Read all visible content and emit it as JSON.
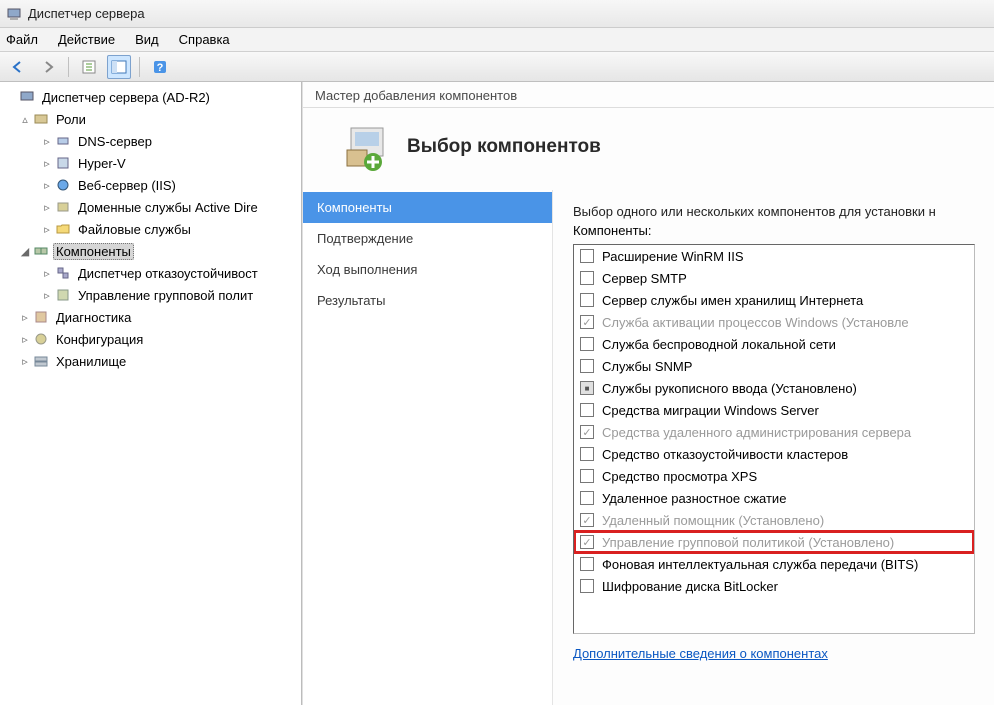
{
  "titlebar": {
    "title": "Диспетчер сервера"
  },
  "menubar": {
    "file": "Файл",
    "action": "Действие",
    "view": "Вид",
    "help": "Справка"
  },
  "tree": {
    "root": "Диспетчер сервера (AD-R2)",
    "roles": "Роли",
    "dns": "DNS-сервер",
    "hyperv": "Hyper-V",
    "iis": "Веб-сервер (IIS)",
    "addomain": "Доменные службы Active Dire",
    "fileservices": "Файловые службы",
    "components": "Компоненты",
    "failover": "Диспетчер отказоустойчивост",
    "gpm": "Управление групповой полит",
    "diagnostics": "Диагностика",
    "config": "Конфигурация",
    "storage": "Хранилище"
  },
  "wizard": {
    "title": "Мастер добавления компонентов",
    "header": "Выбор компонентов",
    "steps": {
      "components": "Компоненты",
      "confirm": "Подтверждение",
      "progress": "Ход выполнения",
      "results": "Результаты"
    },
    "desc": "Выбор одного или нескольких компонентов для установки н",
    "listLabel": "Компоненты:",
    "moreInfo": "Дополнительные сведения о компонентах"
  },
  "features": [
    {
      "label": "Расширение WinRM IIS",
      "state": "unchecked"
    },
    {
      "label": "Сервер SMTP",
      "state": "unchecked"
    },
    {
      "label": "Сервер службы имен хранилищ Интернета",
      "state": "unchecked"
    },
    {
      "label": "Служба активации процессов Windows (Установле",
      "state": "checked-disabled"
    },
    {
      "label": "Служба беспроводной локальной сети",
      "state": "unchecked"
    },
    {
      "label": "Службы SNMP",
      "state": "unchecked"
    },
    {
      "label": "Службы рукописного ввода (Установлено)",
      "state": "partial"
    },
    {
      "label": "Средства миграции Windows Server",
      "state": "unchecked"
    },
    {
      "label": "Средства удаленного администрирования сервера",
      "state": "checked-disabled"
    },
    {
      "label": "Средство отказоустойчивости кластеров",
      "state": "unchecked"
    },
    {
      "label": "Средство просмотра XPS",
      "state": "unchecked"
    },
    {
      "label": "Удаленное разностное сжатие",
      "state": "unchecked"
    },
    {
      "label": "Удаленный помощник (Установлено)",
      "state": "checked-disabled"
    },
    {
      "label": "Управление групповой политикой (Установлено)",
      "state": "checked-disabled",
      "highlight": true
    },
    {
      "label": "Фоновая интеллектуальная служба передачи (BITS)",
      "state": "unchecked"
    },
    {
      "label": "Шифрование диска BitLocker",
      "state": "unchecked"
    }
  ]
}
